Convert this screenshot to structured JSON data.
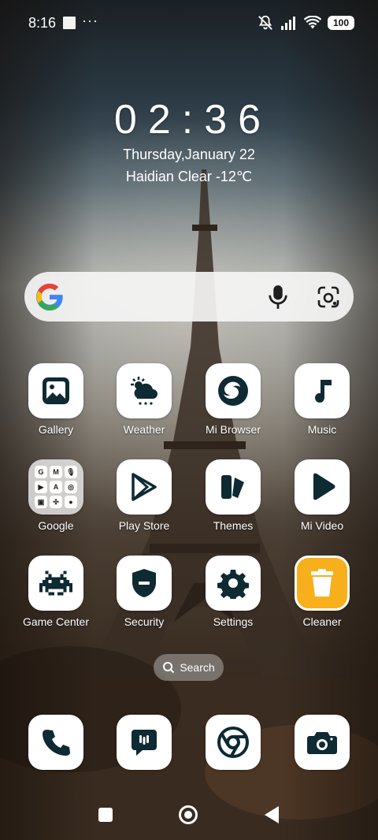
{
  "status_bar": {
    "time": "8:16",
    "more": "···",
    "battery": "100"
  },
  "clock_widget": {
    "time": "02:36",
    "date": "Thursday,January 22",
    "weather": "Haidian Clear -12℃"
  },
  "search_widget": {
    "logo_icon": "google-g-icon",
    "mic_icon": "mic-icon",
    "lens_icon": "google-lens-icon"
  },
  "apps": [
    {
      "label": "Gallery",
      "icon": "gallery-icon"
    },
    {
      "label": "Weather",
      "icon": "weather-icon"
    },
    {
      "label": "Mi Browser",
      "icon": "browser-icon"
    },
    {
      "label": "Music",
      "icon": "music-note-icon"
    },
    {
      "label": "Google",
      "icon": "folder-icon"
    },
    {
      "label": "Play Store",
      "icon": "play-store-icon"
    },
    {
      "label": "Themes",
      "icon": "themes-icon"
    },
    {
      "label": "Mi Video",
      "icon": "play-icon"
    },
    {
      "label": "Game Center",
      "icon": "space-invader-icon"
    },
    {
      "label": "Security",
      "icon": "shield-icon"
    },
    {
      "label": "Settings",
      "icon": "gear-icon"
    },
    {
      "label": "Cleaner",
      "icon": "trash-icon"
    }
  ],
  "google_folder": [
    "G",
    "M",
    "🎙",
    "▶",
    "A",
    "◎",
    "▣",
    "✣",
    "●"
  ],
  "app_search": {
    "label": "Search"
  },
  "dock": [
    {
      "icon": "phone-icon"
    },
    {
      "icon": "message-icon"
    },
    {
      "icon": "chrome-icon"
    },
    {
      "icon": "camera-icon"
    }
  ],
  "colors": {
    "tile": "#ffffff",
    "icon_dark": "#0e2a33",
    "cleaner": "#f7b01c"
  }
}
